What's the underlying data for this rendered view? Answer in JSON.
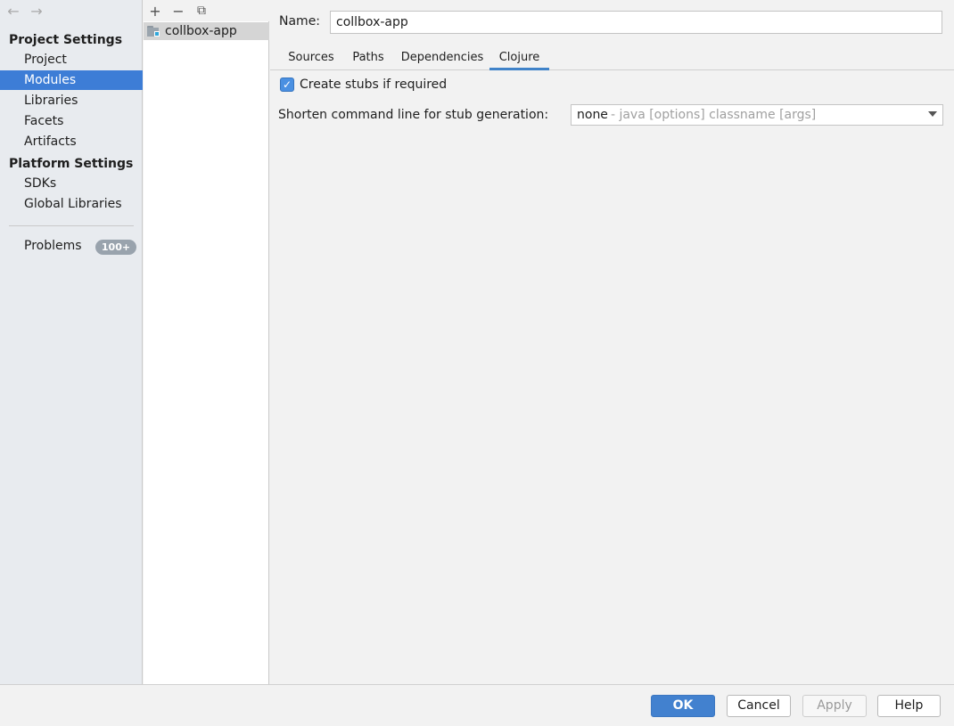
{
  "nav": {
    "back_icon": "←",
    "forward_icon": "→"
  },
  "sidebar": {
    "project_section": "Project Settings",
    "project_items": [
      "Project",
      "Modules",
      "Libraries",
      "Facets",
      "Artifacts"
    ],
    "selected_item": "Modules",
    "platform_section": "Platform Settings",
    "platform_items": [
      "SDKs",
      "Global Libraries"
    ],
    "problems_label": "Problems",
    "problems_count": "100+"
  },
  "modules": {
    "toolbar": {
      "add_icon": "+",
      "remove_icon": "−",
      "copy_icon": "⧉"
    },
    "items": [
      "collbox-app"
    ]
  },
  "content": {
    "name_label": "Name:",
    "name_value": "collbox-app",
    "tabs": [
      "Sources",
      "Paths",
      "Dependencies",
      "Clojure"
    ],
    "active_tab": "Clojure",
    "create_stubs_label": "Create stubs if required",
    "create_stubs_checked": true,
    "checkbox_mark": "✓",
    "shorten_label": "Shorten command line for stub generation:",
    "shorten_value": "none",
    "shorten_desc": "- java [options] classname [args]"
  },
  "buttons": {
    "ok": "OK",
    "cancel": "Cancel",
    "apply": "Apply",
    "help": "Help"
  },
  "colors": {
    "selection": "#3d7dd6",
    "primary_button": "#4281cf",
    "tab_underline": "#4083c9",
    "badge": "#99a3ad"
  }
}
